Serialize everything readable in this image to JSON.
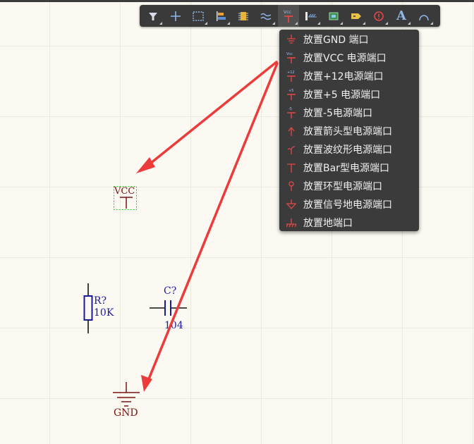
{
  "toolbar": {
    "tools": [
      {
        "icon": "filter-icon"
      },
      {
        "icon": "crosshair-icon"
      },
      {
        "icon": "select-rect-icon"
      },
      {
        "icon": "align-icon"
      },
      {
        "icon": "component-icon"
      },
      {
        "icon": "wire-icon"
      },
      {
        "icon": "power-port-icon",
        "label": "Vcc",
        "active": true
      },
      {
        "icon": "bus-icon"
      },
      {
        "icon": "sheet-symbol-icon"
      },
      {
        "icon": "port-icon"
      },
      {
        "icon": "directive-icon"
      },
      {
        "icon": "text-icon",
        "label": "A"
      },
      {
        "icon": "arc-icon"
      }
    ]
  },
  "menu": {
    "items": [
      {
        "label": "放置GND 端口",
        "icon": "gnd-power-icon"
      },
      {
        "label": "放置VCC 电源端口",
        "icon": "vcc-power-icon",
        "tag": "Vcc"
      },
      {
        "label": "放置+12电源端口",
        "icon": "plus12-power-icon",
        "tag": "+12"
      },
      {
        "label": "放置+5 电源端口",
        "icon": "plus5-power-icon",
        "tag": "+5"
      },
      {
        "label": "放置-5电源端口",
        "icon": "minus5-power-icon",
        "tag": "-5"
      },
      {
        "label": "放置箭头型电源端口",
        "icon": "arrow-power-icon"
      },
      {
        "label": "放置波纹形电源端口",
        "icon": "wave-power-icon"
      },
      {
        "label": "放置Bar型电源端口",
        "icon": "bar-power-icon"
      },
      {
        "label": "放置环型电源端口",
        "icon": "circle-power-icon"
      },
      {
        "label": "放置信号地电源端口",
        "icon": "signal-ground-icon"
      },
      {
        "label": "放置地端口",
        "icon": "earth-ground-icon"
      }
    ]
  },
  "canvas": {
    "vcc_port": {
      "text": "VCC"
    },
    "resistor": {
      "designator": "R?",
      "value": "10K"
    },
    "capacitor": {
      "designator": "C?",
      "value": "104"
    },
    "gnd_port": {
      "text": "GND"
    }
  },
  "colors": {
    "canvas_bg": "#fbf9f1",
    "grid": "#ece9dd",
    "toolbar_bg": "#3a3a3a",
    "menu_bg": "#3b3b3b",
    "menu_text": "#f0f0f0",
    "power_port": "#7a1414",
    "component_text": "#1a1a9a",
    "arrow": "#ec3b3b",
    "selection": "#22cc22"
  }
}
